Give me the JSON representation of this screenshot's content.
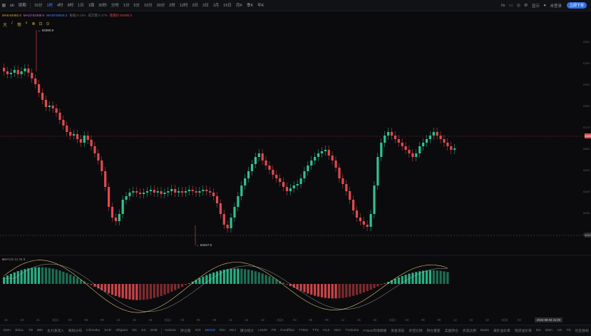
{
  "toolbar": {
    "symbol_icon": "menu-grid-icon",
    "items": [
      {
        "label": "ab",
        "active": false
      },
      {
        "label": "周期",
        "active": false
      },
      {
        "label": "15分",
        "active": false
      },
      {
        "label": "1时",
        "active": true
      },
      {
        "label": "4时",
        "active": false
      },
      {
        "label": "8时",
        "active": false
      },
      {
        "label": "1日",
        "active": false
      },
      {
        "label": "1周",
        "active": false
      },
      {
        "label": "30秒",
        "active": false
      },
      {
        "label": "分时",
        "active": false
      },
      {
        "label": "1分",
        "active": false
      },
      {
        "label": "5分",
        "active": false
      },
      {
        "label": "10分",
        "active": false
      },
      {
        "label": "30分",
        "active": false
      },
      {
        "label": "2时",
        "active": false
      },
      {
        "label": "12时",
        "active": false
      },
      {
        "label": "2日",
        "active": false
      },
      {
        "label": "3日",
        "active": false
      },
      {
        "label": "1月",
        "active": false
      },
      {
        "label": "15日",
        "active": false
      },
      {
        "label": "月K",
        "active": false
      },
      {
        "label": "季K",
        "active": false
      },
      {
        "label": "年K",
        "active": false
      }
    ],
    "right_items": [
      "0s",
      "显示"
    ],
    "right_pill": "立即下单",
    "user_label": "未登录"
  },
  "legend": [
    "MA5:63482.4",
    "MA10:63488.9",
    "MA30:63615.3",
    "振幅:0.13%",
    "成交量:0.17%",
    "收盘价:63490.3"
  ],
  "draw_tools": [
    "大",
    "/",
    "等",
    "×",
    "⊗",
    "⊡",
    "⊙"
  ],
  "callouts": {
    "high": "63390.8",
    "low": "63227.0"
  },
  "price_axis": [
    "6310",
    "6300",
    "6290",
    "6280",
    "6270",
    "6260",
    "6250",
    "6240",
    "6230",
    "6220"
  ],
  "price_tags": {
    "current": "63490",
    "low_line": "63227"
  },
  "macd_label": {
    "title": "MACD",
    "params": "MACD 12 26 9"
  },
  "date_axis": [
    "15",
    "18",
    "21",
    "8月1",
    "03",
    "06",
    "09",
    "12",
    "15",
    "18",
    "8月2",
    "03",
    "06",
    "09",
    "12",
    "15",
    "18",
    "8月3",
    "03",
    "06",
    "09",
    "12",
    "15",
    "18",
    "8月4",
    "03",
    "06",
    "09",
    "12",
    "15",
    "18",
    "8月5",
    "03",
    "06",
    "09"
  ],
  "date_box": "2024-08-04 21:00",
  "bottom_tabs": [
    {
      "label": "EMA",
      "active": false
    },
    {
      "label": "BOLL",
      "active": false
    },
    {
      "label": "TD",
      "active": false
    },
    {
      "label": "BBI",
      "active": false
    },
    {
      "label": "主力净流入",
      "active": false
    },
    {
      "label": "筹码分布",
      "active": false
    },
    {
      "label": "Ichimoku",
      "active": false
    },
    {
      "label": "SAR",
      "active": false
    },
    {
      "label": "Alligator",
      "active": false
    },
    {
      "label": "DC",
      "active": false
    },
    {
      "label": "KC",
      "active": false
    },
    {
      "label": "ENE",
      "active": false
    },
    {
      "label": "Volume",
      "active": false
    },
    {
      "label": "持仓量",
      "active": false
    },
    {
      "label": "ICR",
      "active": false
    },
    {
      "label": "MACD",
      "active": true
    },
    {
      "label": "RSI",
      "active": false
    },
    {
      "label": "KDJ",
      "active": false
    },
    {
      "label": "爆仓统计",
      "active": false
    },
    {
      "label": "LSUR",
      "active": false
    },
    {
      "label": "FR",
      "active": false
    },
    {
      "label": "Fundflow",
      "active": false
    },
    {
      "label": "TTMU",
      "active": false
    },
    {
      "label": "TTS",
      "active": false
    },
    {
      "label": "HLS",
      "active": false
    },
    {
      "label": "NSV",
      "active": false
    },
    {
      "label": "TVolume",
      "active": false
    },
    {
      "label": "FTBIS市场情绪",
      "active": false
    },
    {
      "label": "资金流向",
      "active": false
    },
    {
      "label": "多空比例",
      "active": false
    },
    {
      "label": "持仓量变",
      "active": false
    },
    {
      "label": "实盘持仓",
      "active": false
    },
    {
      "label": "买卖比例",
      "active": false
    },
    {
      "label": "Basis",
      "active": false
    },
    {
      "label": "海外溢价率",
      "active": false
    },
    {
      "label": "现货溢价率",
      "active": false
    },
    {
      "label": "MA",
      "active": false
    },
    {
      "label": "EMA",
      "active": false
    },
    {
      "label": "AO",
      "active": false
    },
    {
      "label": "TD",
      "active": false
    },
    {
      "label": "社区指标",
      "active": false
    }
  ],
  "colors": {
    "up": "#2ec28f",
    "down": "#e04a4f",
    "macd_dif": "#d9c27a",
    "macd_dea": "#c7c9ce",
    "accent": "#2f6fe8"
  }
}
